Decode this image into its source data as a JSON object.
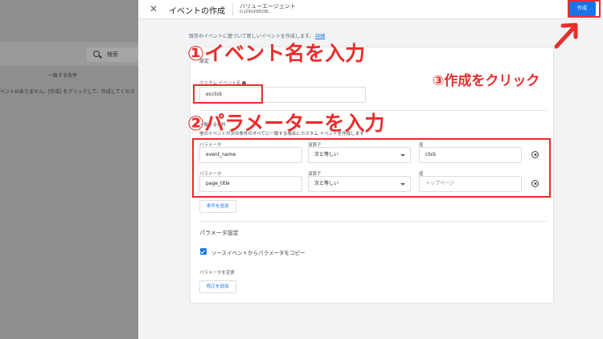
{
  "background": {
    "search_label": "検索",
    "column_header": "一致する条件",
    "empty_message": "ベントはありません。[作成] をクリックして、作成してくださ"
  },
  "header": {
    "title": "イベントの作成",
    "property_name": "バリューエージェント",
    "property_id": "G-J59GP9B2BL",
    "create_label": "作成"
  },
  "intro": {
    "text": "既存のイベントに基づいて新しいイベントを作成します。",
    "link_label": "詳細"
  },
  "settings": {
    "section_label": "設定",
    "custom_event_label": "カスタム イベント名",
    "custom_event_value": "ecclick"
  },
  "conditions": {
    "header": "一致する条件",
    "description": "他のイベントが次の条件のすべてに一致する場合にカスタム イベントを作成します",
    "param_label": "パラメータ",
    "operator_label": "演算子",
    "value_label": "値",
    "rows": [
      {
        "parameter": "event_name",
        "operator": "次と等しい",
        "value": "click",
        "value_placeholder": ""
      },
      {
        "parameter": "page_title",
        "operator": "次と等しい",
        "value": "",
        "value_placeholder": "トップページ"
      }
    ],
    "add_condition_label": "条件を追加"
  },
  "parameters": {
    "title": "パラメータ設定",
    "copy_checkbox_label": "ソースイベントからパラメータをコピー",
    "copy_checked": true,
    "modify_label": "パラメータを変更",
    "add_modification_label": "修正を追加"
  },
  "annotations": {
    "step1": "①イベント名を入力",
    "step2": "②パラメーターを入力",
    "step3": "③作成をクリック",
    "color": "#ea2d2d"
  },
  "colors": {
    "accent": "#1a73e8",
    "annotation": "#ea2d2d"
  }
}
